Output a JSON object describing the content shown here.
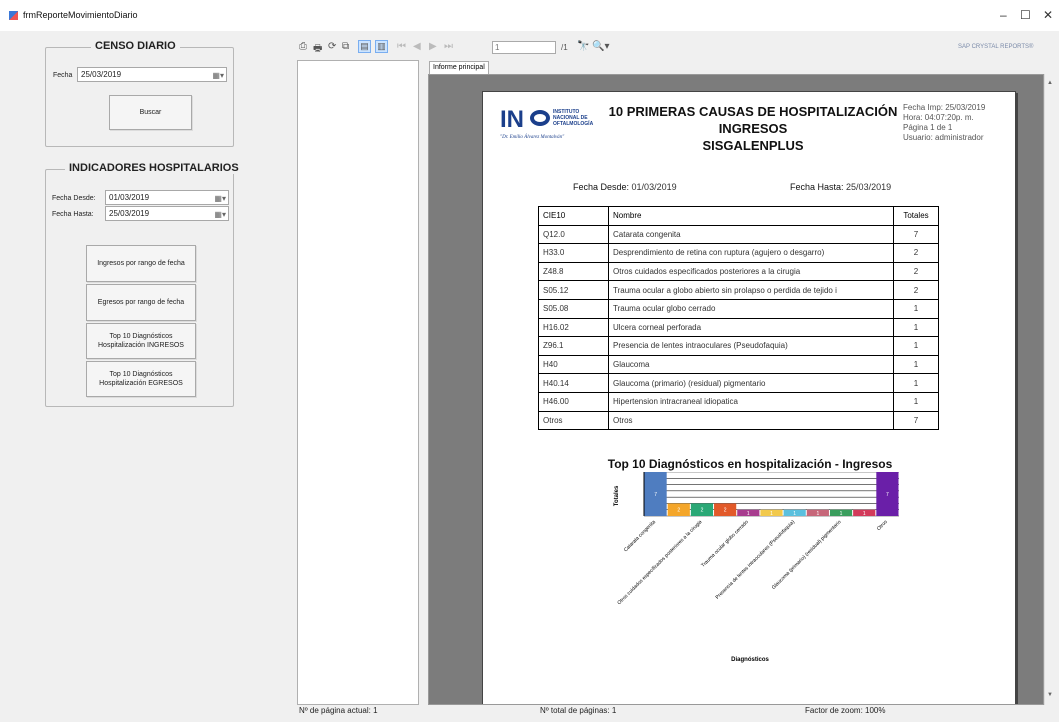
{
  "window": {
    "title": "frmReporteMovimientoDiario",
    "minimize": "–",
    "maximize": "☐",
    "close": "✕"
  },
  "censo": {
    "legend": "CENSO DIARIO",
    "fecha_label": "Fecha",
    "fecha_value": "25/03/2019",
    "buscar": "Buscar"
  },
  "indicadores": {
    "legend": "INDICADORES HOSPITALARIOS",
    "desde_label": "Fecha Desde:",
    "desde_value": "01/03/2019",
    "hasta_label": "Fecha Hasta:",
    "hasta_value": "25/03/2019",
    "buttons": [
      "Ingresos por rango de fecha",
      "Egresos por rango de fecha",
      "Top 10 Diagnósticos Hospitalización INGRESOS",
      "Top 10 Diagnósticos Hospitalización EGRESOS"
    ]
  },
  "toolbar": {
    "page_input": "1",
    "page_total": "/1",
    "brand": "SAP CRYSTAL REPORTS®"
  },
  "tab": "Informe principal",
  "status": {
    "current": "Nº de página actual: 1",
    "total": "Nº total de páginas: 1",
    "zoom": "Factor de zoom: 100%"
  },
  "report": {
    "logo": {
      "letters": "IN",
      "line1": "INSTITUTO",
      "line2": "NACIONAL DE",
      "line3": "OFTALMOLOGÍA",
      "tagline": "\"Dr. Emilio Álvarez Montalván\""
    },
    "title1": "10 PRIMERAS CAUSAS DE HOSPITALIZACIÓN",
    "title2": "INGRESOS",
    "title3": "SISGALENPLUS",
    "meta": [
      "Fecha Imp: 25/03/2019",
      "Hora:   04:07:20p. m.",
      "Página 1 de 1",
      "Usuario:  administrador"
    ],
    "desde_label": "Fecha Desde:",
    "desde_value": "01/03/2019",
    "hasta_label": "Fecha Hasta:",
    "hasta_value": "25/03/2019",
    "headers": [
      "CIE10",
      "Nombre",
      "Totales"
    ],
    "rows": [
      [
        "Q12.0",
        "Catarata congenita",
        "7"
      ],
      [
        "H33.0",
        "Desprendimiento de retina con ruptura (agujero o desgarro)",
        "2"
      ],
      [
        "Z48.8",
        "Otros cuidados especificados posteriores a la cirugia",
        "2"
      ],
      [
        "S05.12",
        "Trauma ocular a globo abierto sin prolapso o perdida de tejido i",
        "2"
      ],
      [
        "S05.08",
        "Trauma ocular globo cerrado",
        "1"
      ],
      [
        "H16.02",
        "Ulcera corneal perforada",
        "1"
      ],
      [
        "Z96.1",
        "Presencia de lentes intraoculares (Pseudofaquia)",
        "1"
      ],
      [
        "H40",
        "Glaucoma",
        "1"
      ],
      [
        "H40.14",
        "Glaucoma (primario) (residual) pigmentario",
        "1"
      ],
      [
        "H46.00",
        "Hipertension intracraneal idiopatica",
        "1"
      ],
      [
        "Otros",
        "Otros",
        "7"
      ]
    ]
  },
  "chart_data": {
    "type": "bar",
    "title": "Top 10 Diagnósticos en hospitalización - Ingresos",
    "xlabel": "Diagnósticos",
    "ylabel": "Totales",
    "categories": [
      "Catarata congenita",
      "Desprendimiento de retina con ruptura (agujero o desgarro)",
      "Otros cuidados especificados posteriores a la cirugia",
      "Trauma ocular a globo abierto sin prolapso o perdida de tejido i",
      "Trauma ocular globo cerrado",
      "Ulcera corneal perforada",
      "Presencia de lentes intraoculares (Pseudofaquia)",
      "Glaucoma",
      "Glaucoma (primario) (residual) pigmentario",
      "Hipertension intracraneal idiopatica",
      "Otros"
    ],
    "visible_tick_labels": [
      "Catarata congenita",
      "Otros cuidados especificados posteriores a la cirugia",
      "Trauma ocular globo cerrado",
      "Presencia de lentes intraoculares (Pseudofaquia)",
      "Glaucoma (primario) (residual) pigmentario",
      "Otros"
    ],
    "values": [
      7,
      2,
      2,
      2,
      1,
      1,
      1,
      1,
      1,
      1,
      7
    ],
    "data_labels": [
      "7",
      "2",
      "2",
      "2",
      "1",
      "1",
      "1",
      "1",
      "1",
      "1",
      "7"
    ],
    "colors": [
      "#4f7dc0",
      "#f4a62a",
      "#2aa876",
      "#e25a2a",
      "#a83c8f",
      "#f2c94c",
      "#5bc0de",
      "#c7677a",
      "#3a9d5d",
      "#d23a5a",
      "#6a1fa8"
    ],
    "ylim": [
      0,
      7
    ],
    "grid": true
  }
}
